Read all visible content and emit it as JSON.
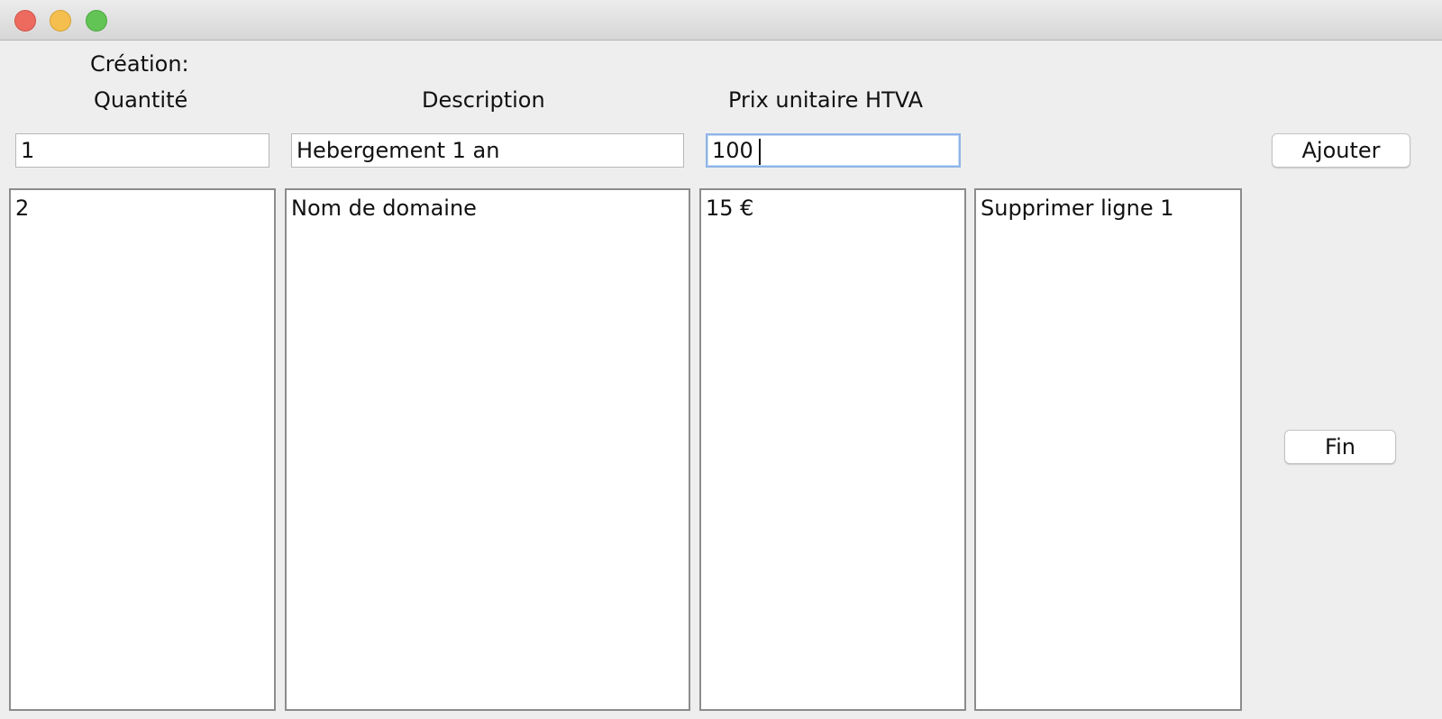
{
  "window": {
    "controls": [
      "close",
      "minimize",
      "maximize"
    ]
  },
  "form": {
    "section_label": "Création:",
    "headers": {
      "quantity": "Quantité",
      "description": "Description",
      "unit_price": "Prix unitaire HTVA"
    },
    "inputs": {
      "quantity": "1",
      "description": "Hebergement 1 an",
      "unit_price": "100 "
    },
    "add_button": "Ajouter",
    "finish_button": "Fin"
  },
  "lists": {
    "quantity": [
      "2"
    ],
    "description": [
      "Nom de domaine"
    ],
    "unit_price": [
      "15 €"
    ],
    "actions": [
      "Supprimer ligne 1"
    ]
  }
}
